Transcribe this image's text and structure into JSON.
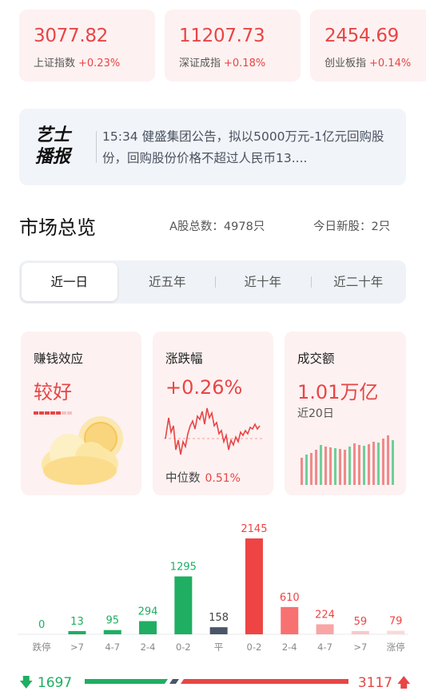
{
  "indices": [
    {
      "value": "3077.82",
      "name": "上证指数",
      "change": "+0.23%"
    },
    {
      "value": "11207.73",
      "name": "深证成指",
      "change": "+0.18%"
    },
    {
      "value": "2454.69",
      "name": "创业板指",
      "change": "+0.14%"
    }
  ],
  "news": {
    "logo_line1": "艺士",
    "logo_line2": "播报",
    "text": "15:34 健盛集团公告，拟以5000万元-1亿元回购股份，回购股份价格不超过人民币13...."
  },
  "overview": {
    "title": "市场总览",
    "a_shares": "A股总数：4978只",
    "new_shares": "今日新股：2只"
  },
  "tabs": [
    "近一日",
    "近五年",
    "近十年",
    "近二十年"
  ],
  "cards": {
    "sentiment": {
      "title": "赚钱效应",
      "value": "较好"
    },
    "change": {
      "title": "涨跌幅",
      "value": "+0.26%",
      "median_label": "中位数",
      "median_value": "0.51%"
    },
    "turnover": {
      "title": "成交额",
      "value": "1.01万亿",
      "sub": "近20日"
    }
  },
  "chart_data": {
    "type": "bar",
    "categories": [
      "跌停",
      ">7",
      "4-7",
      "2-4",
      "0-2",
      "平",
      "0-2",
      "2-4",
      "4-7",
      ">7",
      "涨停"
    ],
    "values": [
      0,
      13,
      95,
      294,
      1295,
      158,
      2145,
      610,
      224,
      59,
      79
    ],
    "colors": [
      "#1fae62",
      "#1fae62",
      "#1fae62",
      "#1fae62",
      "#1fae62",
      "#4a5568",
      "#ef4444",
      "#f87171",
      "#f8a5a5",
      "#f9c8c8",
      "#fbd9d9"
    ],
    "label_colors": [
      "#1fae62",
      "#1fae62",
      "#1fae62",
      "#1fae62",
      "#1fae62",
      "#444444",
      "#ef4444",
      "#ef4444",
      "#ef4444",
      "#ef4444",
      "#ef4444"
    ]
  },
  "breadth": {
    "down": "1697",
    "up": "3117",
    "down_color": "#1fae62",
    "up_color": "#e84545"
  }
}
